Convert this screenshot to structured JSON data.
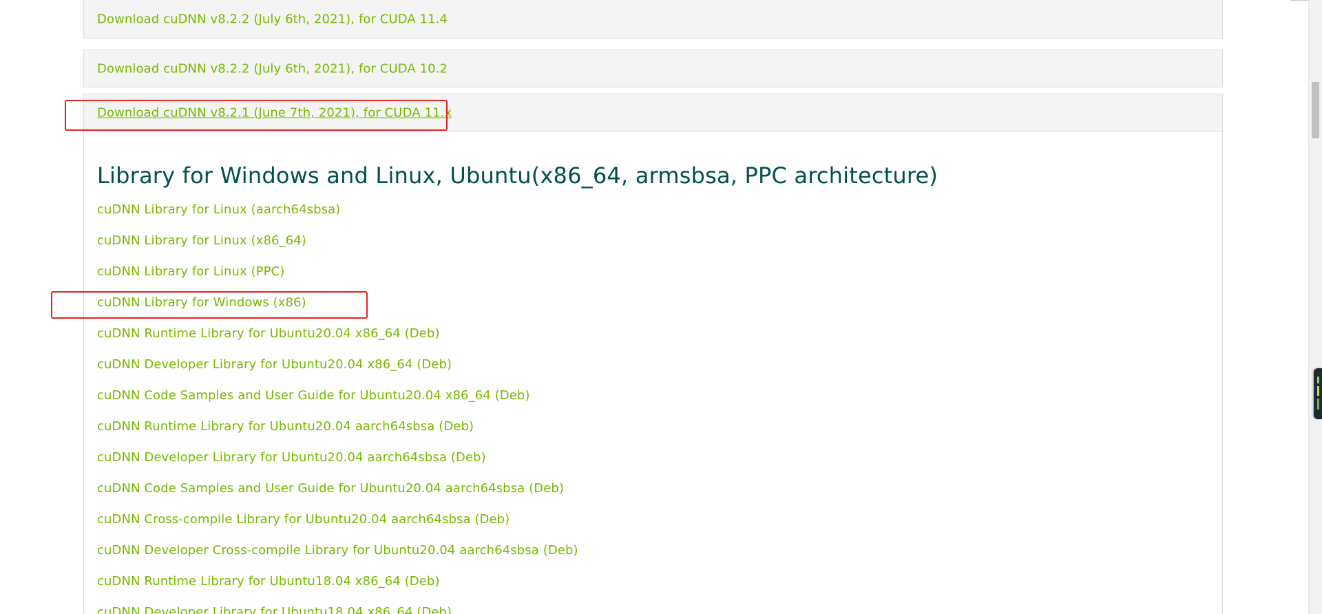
{
  "downloads": [
    {
      "label": "Download cuDNN v8.2.2 (July 6th, 2021), for CUDA 11.4"
    },
    {
      "label": "Download cuDNN v8.2.2 (July 6th, 2021), for CUDA 10.2"
    },
    {
      "label": "Download cuDNN v8.2.1 (June 7th, 2021), for CUDA 11.x"
    }
  ],
  "section": {
    "title": "Library for Windows and Linux, Ubuntu(x86_64, armsbsa, PPC architecture)",
    "links": [
      "cuDNN Library for Linux (aarch64sbsa)",
      "cuDNN Library for Linux (x86_64)",
      "cuDNN Library for Linux (PPC)",
      "cuDNN Library for Windows (x86)",
      "cuDNN Runtime Library for Ubuntu20.04 x86_64 (Deb)",
      "cuDNN Developer Library for Ubuntu20.04 x86_64 (Deb)",
      "cuDNN Code Samples and User Guide for Ubuntu20.04 x86_64 (Deb)",
      "cuDNN Runtime Library for Ubuntu20.04 aarch64sbsa (Deb)",
      "cuDNN Developer Library for Ubuntu20.04 aarch64sbsa (Deb)",
      "cuDNN Code Samples and User Guide for Ubuntu20.04 aarch64sbsa (Deb)",
      "cuDNN Cross-compile Library for Ubuntu20.04 aarch64sbsa (Deb)",
      "cuDNN Developer Cross-compile Library for Ubuntu20.04 aarch64sbsa (Deb)",
      "cuDNN Runtime Library for Ubuntu18.04 x86_64 (Deb)",
      "cuDNN Developer Library for Ubuntu18.04 x86_64 (Deb)"
    ]
  },
  "colors": {
    "link": "#76b900",
    "title": "#00504d",
    "row_background": "#f4f4f4",
    "highlight": "#e8221b"
  }
}
